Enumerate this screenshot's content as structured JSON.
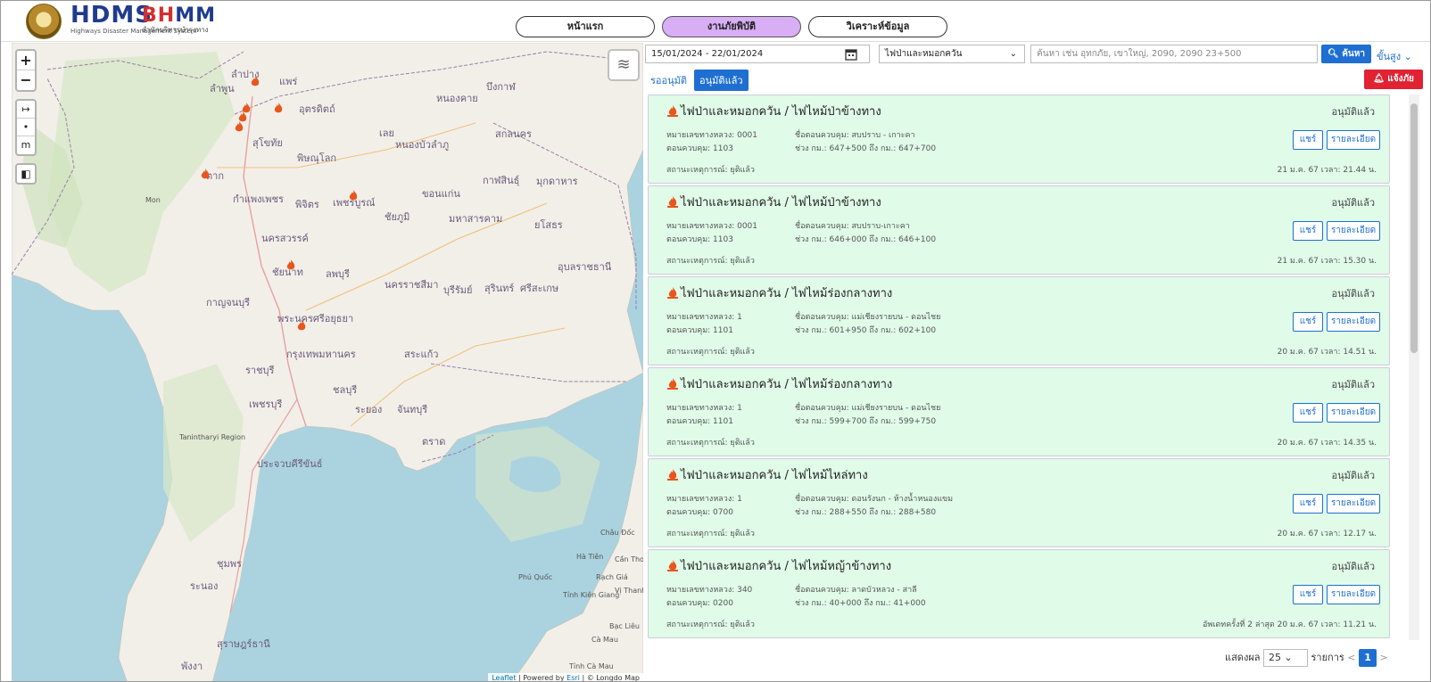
{
  "brand": {
    "hdms": "HDMS",
    "hdms_sub": "Highways Disaster Management System",
    "bhmm_b": "BH",
    "bhmm_m": "MM",
    "bhmm_sub": "สำนักบริหารบำรุงทาง"
  },
  "nav": {
    "home": "หน้าแรก",
    "disaster": "งานภัยพิบัติ",
    "analysis": "วิเคราะห์ข้อมูล"
  },
  "map": {
    "zoom_in": "+",
    "zoom_out": "−",
    "tool_arrow": "↦",
    "tool_point": "•",
    "tool_m": "m",
    "attribution_leaflet": "Leaflet",
    "attribution_rest": " | Powered by ",
    "attribution_esri": "Esri",
    "attribution_longdo": " | © Longdo Map",
    "labels": [
      {
        "text": "ลำปาง"
      },
      {
        "text": "แพร่"
      },
      {
        "text": "ลำพูน"
      },
      {
        "text": "อุตรดิตถ์"
      },
      {
        "text": "สุโขทัย"
      },
      {
        "text": "พิษณุโลก"
      },
      {
        "text": "เลย"
      },
      {
        "text": "หนองบัวลำภู"
      },
      {
        "text": "หนองคาย"
      },
      {
        "text": "บึงกาฬ"
      },
      {
        "text": "สกลนคร"
      },
      {
        "text": "ตาก"
      },
      {
        "text": "กำแพงเพชร"
      },
      {
        "text": "พิจิตร"
      },
      {
        "text": "เพชรบูรณ์"
      },
      {
        "text": "ขอนแก่น"
      },
      {
        "text": "กาฬสินธุ์"
      },
      {
        "text": "มุกดาหาร"
      },
      {
        "text": "ชัยภูมิ"
      },
      {
        "text": "มหาสารคาม"
      },
      {
        "text": "ยโสธร"
      },
      {
        "text": "นครสวรรค์"
      },
      {
        "text": "ชัยนาท"
      },
      {
        "text": "ลพบุรี"
      },
      {
        "text": "อุบลราชธานี"
      },
      {
        "text": "นครราชสีมา"
      },
      {
        "text": "บุรีรัมย์"
      },
      {
        "text": "สุรินทร์"
      },
      {
        "text": "ศรีสะเกษ"
      },
      {
        "text": "กาญจนบุรี"
      },
      {
        "text": "พระนครศรีอยุธยา"
      },
      {
        "text": "กรุงเทพมหานคร"
      },
      {
        "text": "สระแก้ว"
      },
      {
        "text": "ราชบุรี"
      },
      {
        "text": "ชลบุรี"
      },
      {
        "text": "เพชรบุรี"
      },
      {
        "text": "ระยอง"
      },
      {
        "text": "จันทบุรี"
      },
      {
        "text": "ตราด"
      },
      {
        "text": "ประจวบคีรีขันธ์"
      },
      {
        "text": "ชุมพร"
      },
      {
        "text": "ระนอง"
      },
      {
        "text": "สุราษฎร์ธานี"
      },
      {
        "text": "พังงา"
      }
    ],
    "en_labels": [
      {
        "text": "Tanintharyi Region"
      },
      {
        "text": "Phú Quốc"
      },
      {
        "text": "Hà Tiên"
      },
      {
        "text": "Rạch Giá"
      },
      {
        "text": "Cần Thơ"
      },
      {
        "text": "Châu Đốc"
      },
      {
        "text": "Vị Thanh"
      },
      {
        "text": "Tỉnh Kiên Giang"
      },
      {
        "text": "Bạc Liêu"
      },
      {
        "text": "Cà Mau"
      },
      {
        "text": "Tỉnh Cà Mau"
      },
      {
        "text": "Mon"
      }
    ]
  },
  "filters": {
    "date_range": "15/01/2024 - 22/01/2024",
    "calendar_icon": "calendar-icon",
    "type_select": "ไฟป่าและหมอกควัน",
    "search_placeholder": "ค้นหา เช่น อุทกภัย, เขาใหญ่, 2090, 2090 23+500",
    "search_label": "ค้นหา",
    "advanced_label": "ขั้นสูง"
  },
  "tabs": {
    "pending": "รออนุมัติ",
    "approved": "อนุมัติแล้ว"
  },
  "report_label": "แจ้งภัย",
  "labels": {
    "highway_no": "หมายเลขทางหลวง:",
    "control_no": "ตอนควบคุม:",
    "control_name": "ชื่อตอนควบคุม:",
    "range": "ช่วง กม.:",
    "status": "สถานะเหตุการณ์:",
    "share": "แชร์",
    "detail": "รายละเอียด"
  },
  "incidents": [
    {
      "title": "ไฟป่าและหมอกควัน / ไฟไหม้ป่าข้างทาง",
      "approved": "อนุมัติแล้ว",
      "highway": "หมายเลขทางหลวง: 0001",
      "control": "ตอนควบคุม: 1103",
      "control_name": "ชื่อตอนควบคุม: สบปราบ - เกาะคา",
      "range": "ช่วง กม.: 647+500 ถึง กม.: 647+700",
      "status": "สถานะเหตุการณ์: ยุติแล้ว",
      "time": "21 ม.ค. 67 เวลา: 21.44 น."
    },
    {
      "title": "ไฟป่าและหมอกควัน / ไฟไหม้ป่าข้างทาง",
      "approved": "อนุมัติแล้ว",
      "highway": "หมายเลขทางหลวง: 0001",
      "control": "ตอนควบคุม: 1103",
      "control_name": "ชื่อตอนควบคุม: สบปราบ-เกาะคา",
      "range": "ช่วง กม.: 646+000 ถึง กม.: 646+100",
      "status": "สถานะเหตุการณ์: ยุติแล้ว",
      "time": "21 ม.ค. 67 เวลา: 15.30 น."
    },
    {
      "title": "ไฟป่าและหมอกควัน / ไฟไหม้ร่องกลางทาง",
      "approved": "อนุมัติแล้ว",
      "highway": "หมายเลขทางหลวง: 1",
      "control": "ตอนควบคุม: 1101",
      "control_name": "ชื่อตอนควบคุม: แม่เชียงรายบน - ดอนไชย",
      "range": "ช่วง กม.: 601+950 ถึง กม.: 602+100",
      "status": "สถานะเหตุการณ์: ยุติแล้ว",
      "time": "20 ม.ค. 67 เวลา: 14.51 น."
    },
    {
      "title": "ไฟป่าและหมอกควัน / ไฟไหม้ร่องกลางทาง",
      "approved": "อนุมัติแล้ว",
      "highway": "หมายเลขทางหลวง: 1",
      "control": "ตอนควบคุม: 1101",
      "control_name": "ชื่อตอนควบคุม: แม่เชียงรายบน - ดอนไชย",
      "range": "ช่วง กม.: 599+700 ถึง กม.: 599+750",
      "status": "สถานะเหตุการณ์: ยุติแล้ว",
      "time": "20 ม.ค. 67 เวลา: 14.35 น."
    },
    {
      "title": "ไฟป่าและหมอกควัน / ไฟไหม้ไหล่ทาง",
      "approved": "อนุมัติแล้ว",
      "highway": "หมายเลขทางหลวง: 1",
      "control": "ตอนควบคุม: 0700",
      "control_name": "ชื่อตอนควบคุม: ดอนรังนก - ห้างน้ำหนองแขม",
      "range": "ช่วง กม.: 288+550 ถึง กม.: 288+580",
      "status": "สถานะเหตุการณ์: ยุติแล้ว",
      "time": "20 ม.ค. 67 เวลา: 12.17 น."
    },
    {
      "title": "ไฟป่าและหมอกควัน / ไฟไหม้หญ้าข้างทาง",
      "approved": "อนุมัติแล้ว",
      "highway": "หมายเลขทางหลวง: 340",
      "control": "ตอนควบคุม: 0200",
      "control_name": "ชื่อตอนควบคุม: ลาดบัวหลวง - สาลี",
      "range": "ช่วง กม.: 40+000 ถึง กม.: 41+000",
      "status": "สถานะเหตุการณ์: ยุติแล้ว",
      "time": "อัพเดทครั้งที่ 2 ล่าสุด 20 ม.ค. 67 เวลา: 11.21 น."
    }
  ],
  "pager": {
    "show_label": "แสดงผล",
    "page_size": "25",
    "items_label": "รายการ",
    "current_page": "1",
    "prev": "<",
    "next": ">"
  },
  "colors": {
    "primary": "#1e6fd1",
    "card_bg": "#e0fbe8",
    "danger": "#e02232",
    "fire": "#e8561e",
    "nav_active": "#d8aef5"
  }
}
